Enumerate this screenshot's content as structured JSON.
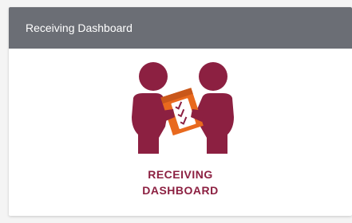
{
  "card": {
    "title": "Receiving Dashboard",
    "label_line_1": "RECEIVING",
    "label_line_2": "DASHBOARD",
    "icon": "people-handing-box-icon"
  },
  "colors": {
    "header_bg": "#6b6e75",
    "header_text": "#ffffff",
    "brand_maroon": "#8c2041",
    "box_orange": "#e8691e"
  }
}
